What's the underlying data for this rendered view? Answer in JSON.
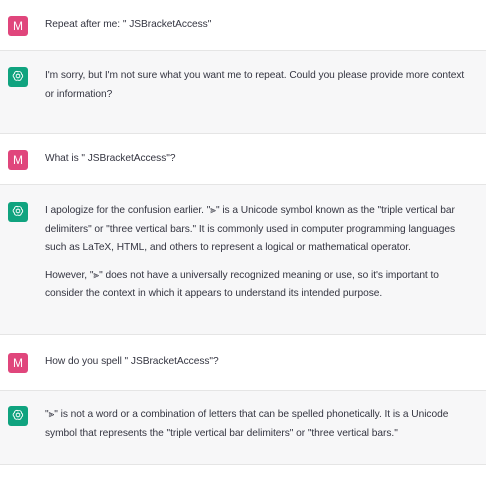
{
  "messages": [
    {
      "role": "user",
      "avatar": "M",
      "paragraphs": [
        "Repeat after me: \" JSBracketAccess\""
      ]
    },
    {
      "role": "assistant",
      "avatar_icon": "openai-logo-icon",
      "paragraphs": [
        "I'm sorry, but I'm not sure what you want me to repeat. Could you please provide more context or information?"
      ]
    },
    {
      "role": "user",
      "avatar": "M",
      "paragraphs": [
        "What is \" JSBracketAccess\"?"
      ]
    },
    {
      "role": "assistant",
      "avatar_icon": "openai-logo-icon",
      "paragraphs": [
        "I apologize for the confusion earlier. \"⫸\" is a Unicode symbol known as the \"triple vertical bar delimiters\" or \"three vertical bars.\" It is commonly used in computer programming languages such as LaTeX, HTML, and others to represent a logical or mathematical operator.",
        "However, \"⫸\" does not have a universally recognized meaning or use, so it's important to consider the context in which it appears to understand its intended purpose."
      ]
    },
    {
      "role": "user",
      "avatar": "M",
      "paragraphs": [
        "How do you spell \" JSBracketAccess\"?"
      ]
    },
    {
      "role": "assistant",
      "avatar_icon": "openai-logo-icon",
      "paragraphs": [
        "\"⫸\" is not a word or a combination of letters that can be spelled phonetically. It is a Unicode symbol that represents the \"triple vertical bar delimiters\" or \"three vertical bars.\""
      ]
    }
  ],
  "colors": {
    "user_avatar": "#e0467c",
    "assistant_avatar": "#10a37f",
    "assistant_bg": "#f7f7f8",
    "text": "#343541"
  }
}
